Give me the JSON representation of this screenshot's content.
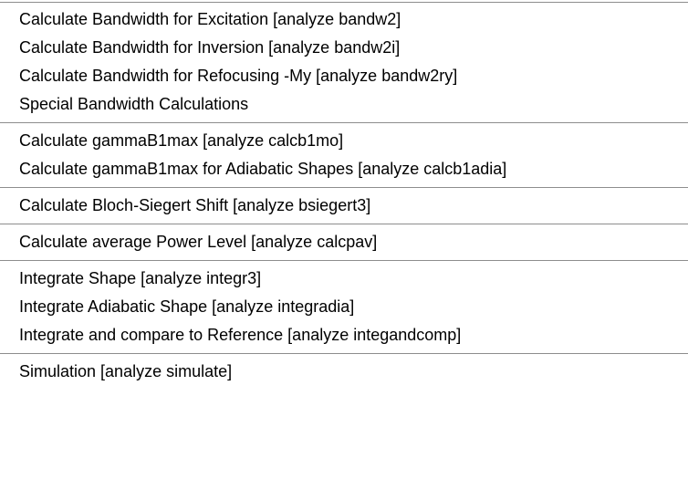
{
  "menu": {
    "groups": [
      {
        "items": [
          {
            "label": "Calculate Bandwidth for Excitation [analyze bandw2]"
          },
          {
            "label": "Calculate Bandwidth for Inversion [analyze bandw2i]"
          },
          {
            "label": "Calculate Bandwidth for Refocusing -My [analyze bandw2ry]"
          },
          {
            "label": "Special Bandwidth Calculations"
          }
        ]
      },
      {
        "items": [
          {
            "label": "Calculate gammaB1max [analyze calcb1mo]"
          },
          {
            "label": "Calculate gammaB1max for Adiabatic Shapes [analyze calcb1adia]"
          }
        ]
      },
      {
        "items": [
          {
            "label": "Calculate Bloch-Siegert Shift [analyze bsiegert3]"
          }
        ]
      },
      {
        "items": [
          {
            "label": "Calculate average Power Level [analyze calcpav]"
          }
        ]
      },
      {
        "items": [
          {
            "label": "Integrate Shape [analyze integr3]"
          },
          {
            "label": "Integrate Adiabatic Shape [analyze integradia]"
          },
          {
            "label": "Integrate and compare to Reference [analyze integandcomp]"
          }
        ]
      },
      {
        "items": [
          {
            "label": "Simulation [analyze simulate]"
          }
        ]
      }
    ]
  }
}
